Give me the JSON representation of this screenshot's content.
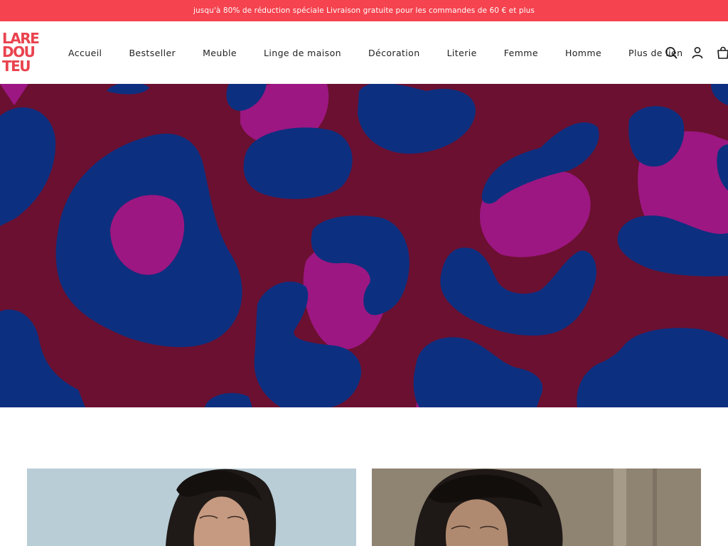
{
  "announcement": {
    "text": "jusqu'à 80% de réduction spéciale Livraison gratuite pour les commandes de 60 € et plus",
    "bg_color": "#f5434f"
  },
  "brand": {
    "logo_rows": [
      "LARE",
      "DOU",
      "TEU"
    ],
    "color": "#e9434e"
  },
  "nav": {
    "items": [
      {
        "label": "Accueil"
      },
      {
        "label": "Bestseller"
      },
      {
        "label": "Meuble"
      },
      {
        "label": "Linge de maison"
      },
      {
        "label": "Décoration"
      },
      {
        "label": "Literie"
      },
      {
        "label": "Femme"
      },
      {
        "label": "Homme"
      },
      {
        "label": "Plus de lien"
      }
    ]
  },
  "header_icons": [
    "search-icon",
    "account-icon",
    "cart-icon"
  ],
  "hero": {
    "colors": {
      "background": "#6b1030",
      "magenta": "#9c1782",
      "blue": "#0d2f80"
    }
  },
  "product_cards": [
    {
      "background": "#b9cdd7"
    },
    {
      "background": "#8f8372"
    }
  ]
}
